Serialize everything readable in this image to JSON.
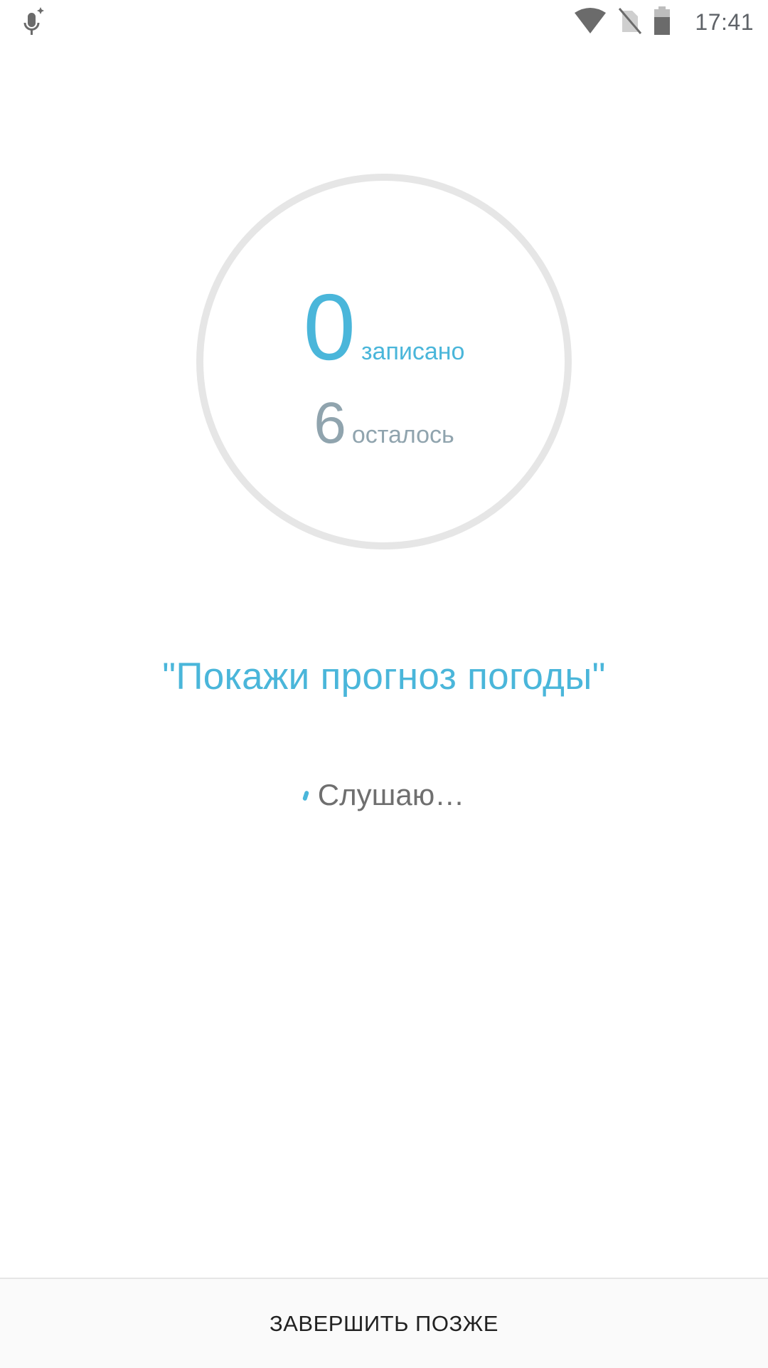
{
  "status_bar": {
    "time": "17:41",
    "icons": [
      "voice-assist-mic-icon",
      "wifi-icon",
      "no-sim-icon",
      "battery-icon"
    ]
  },
  "progress": {
    "recorded_count": "0",
    "recorded_label": "записано",
    "remaining_count": "6",
    "remaining_label": "осталось",
    "completed_fraction": 0
  },
  "prompt": {
    "phrase": "\"Покажи прогноз погоды\""
  },
  "listening": {
    "label": "Слушаю…"
  },
  "bottom": {
    "finish_later_label": "ЗАВЕРШИТЬ ПОЗЖЕ"
  },
  "colors": {
    "accent": "#4ab6da",
    "muted": "#90a4ae",
    "ring": "#e6e6e6"
  }
}
